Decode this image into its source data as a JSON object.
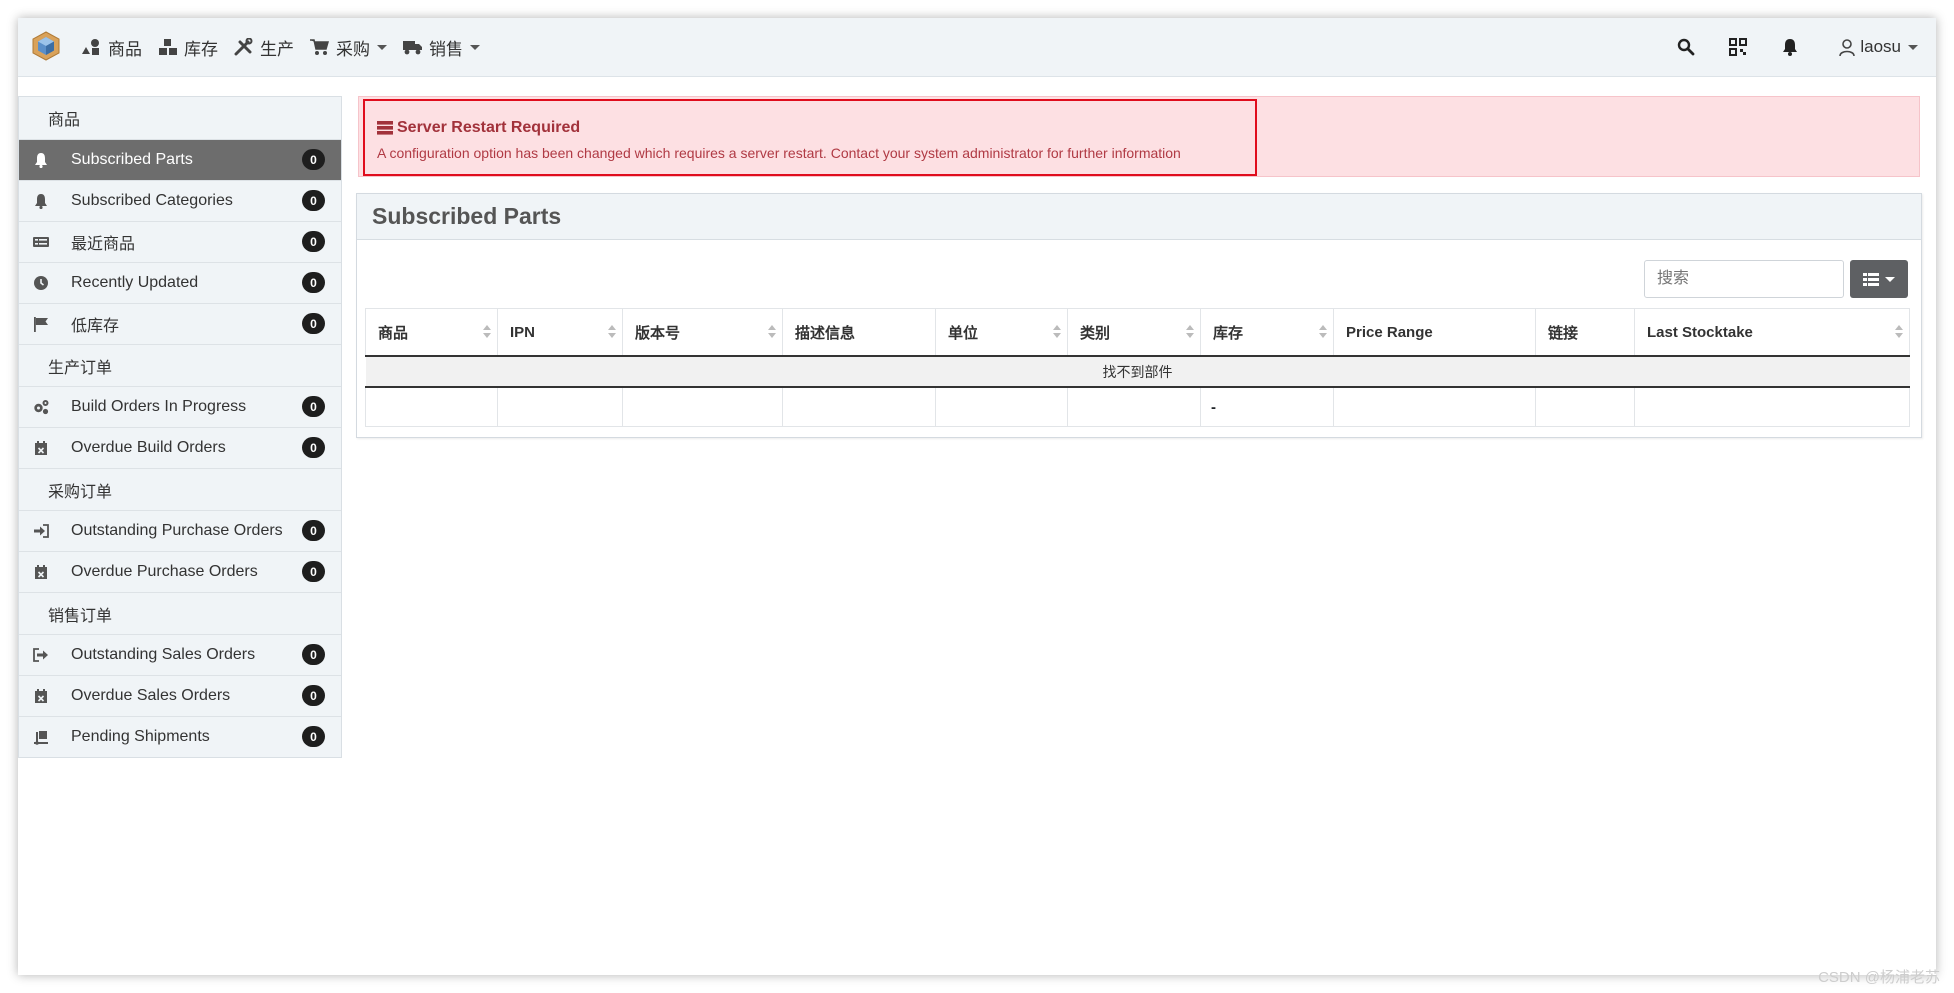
{
  "navbar": {
    "menu": [
      {
        "label": "商品",
        "icon": "shapes-icon",
        "caret": false
      },
      {
        "label": "库存",
        "icon": "boxes-icon",
        "caret": false
      },
      {
        "label": "生产",
        "icon": "tools-icon",
        "caret": false
      },
      {
        "label": "采购",
        "icon": "shopping-cart-icon",
        "caret": true
      },
      {
        "label": "销售",
        "icon": "truck-icon",
        "caret": true
      }
    ],
    "user": "laosu"
  },
  "sidebar": {
    "sections": [
      {
        "title": "商品",
        "items": [
          {
            "label": "Subscribed Parts",
            "count": "0",
            "icon": "bell-icon",
            "active": true
          },
          {
            "label": "Subscribed Categories",
            "count": "0",
            "icon": "bell-icon"
          },
          {
            "label": "最近商品",
            "count": "0",
            "icon": "list-icon"
          },
          {
            "label": "Recently Updated",
            "count": "0",
            "icon": "clock-icon"
          },
          {
            "label": "低库存",
            "count": "0",
            "icon": "flag-icon"
          }
        ]
      },
      {
        "title": "生产订单",
        "items": [
          {
            "label": "Build Orders In Progress",
            "count": "0",
            "icon": "cogs-icon"
          },
          {
            "label": "Overdue Build Orders",
            "count": "0",
            "icon": "calendar-x-icon"
          }
        ]
      },
      {
        "title": "采购订单",
        "items": [
          {
            "label": "Outstanding Purchase Orders",
            "count": "0",
            "icon": "sign-in-icon"
          },
          {
            "label": "Overdue Purchase Orders",
            "count": "0",
            "icon": "calendar-x-icon"
          }
        ]
      },
      {
        "title": "销售订单",
        "items": [
          {
            "label": "Outstanding Sales Orders",
            "count": "0",
            "icon": "sign-out-icon"
          },
          {
            "label": "Overdue Sales Orders",
            "count": "0",
            "icon": "calendar-x-icon"
          },
          {
            "label": "Pending Shipments",
            "count": "0",
            "icon": "dolly-icon"
          }
        ]
      }
    ]
  },
  "alert": {
    "title": "Server Restart Required",
    "message": "A configuration option has been changed which requires a server restart. Contact your system administrator for further information"
  },
  "panel": {
    "title": "Subscribed Parts",
    "search_placeholder": "搜索",
    "columns": [
      "商品",
      "IPN",
      "版本号",
      "描述信息",
      "单位",
      "类别",
      "库存",
      "Price Range",
      "链接",
      "Last Stocktake"
    ],
    "empty_text": "找不到部件",
    "footer_stock": "-"
  },
  "watermark": "CSDN @杨浦老苏",
  "colors": {
    "accent_red": "#e00d1d",
    "alert_bg": "#fde0e3",
    "active_item": "#6d6d6d"
  }
}
